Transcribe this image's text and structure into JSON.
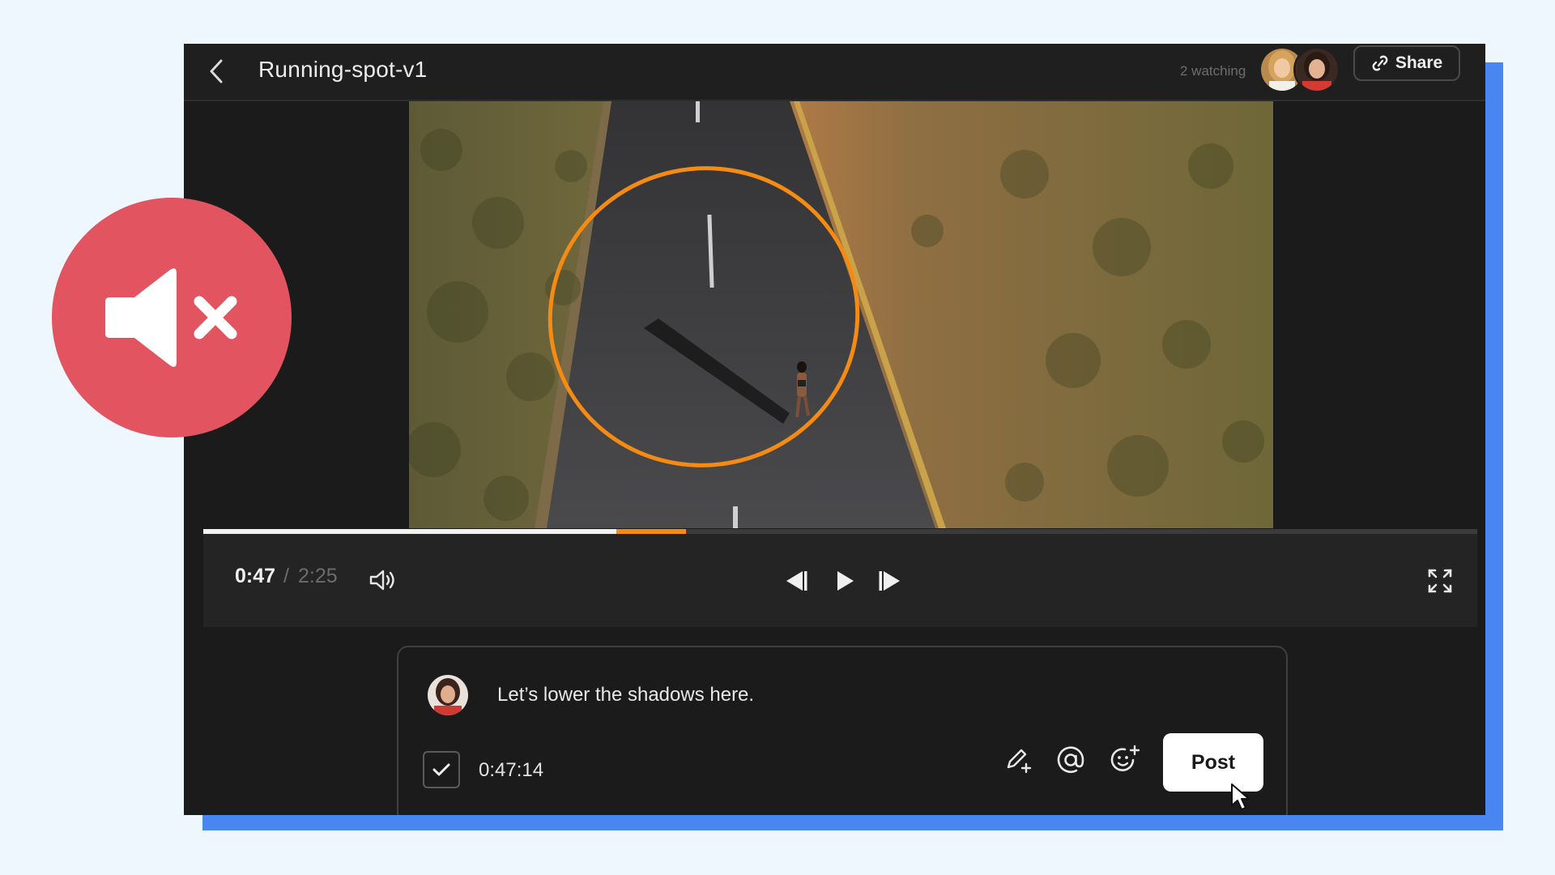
{
  "header": {
    "title": "Running-spot-v1",
    "watching": "2 watching",
    "share_label": "Share"
  },
  "player": {
    "time_current": "0:47",
    "time_separator": "/",
    "time_total": "2:25",
    "progress_fraction": 0.324,
    "range_end_fraction": 0.379
  },
  "comment": {
    "text": "Let’s lower the shadows here.",
    "timestamp": "0:47:14",
    "post_label": "Post",
    "timestamp_checked": true
  },
  "colors": {
    "accent_orange": "#f58b12",
    "mute_badge": "#e25560",
    "shadow_plate": "#4a86f2",
    "app_background": "#1b1b1b"
  },
  "icons": {
    "back": "chevron-left-icon",
    "share": "link-icon",
    "volume": "volume-icon",
    "prev": "step-back-icon",
    "play": "play-icon",
    "next": "step-forward-icon",
    "fullscreen": "fullscreen-icon",
    "draw": "pencil-plus-icon",
    "mention": "at-icon",
    "emoji": "emoji-add-icon",
    "checkbox": "check-icon",
    "mute": "mute-icon"
  }
}
